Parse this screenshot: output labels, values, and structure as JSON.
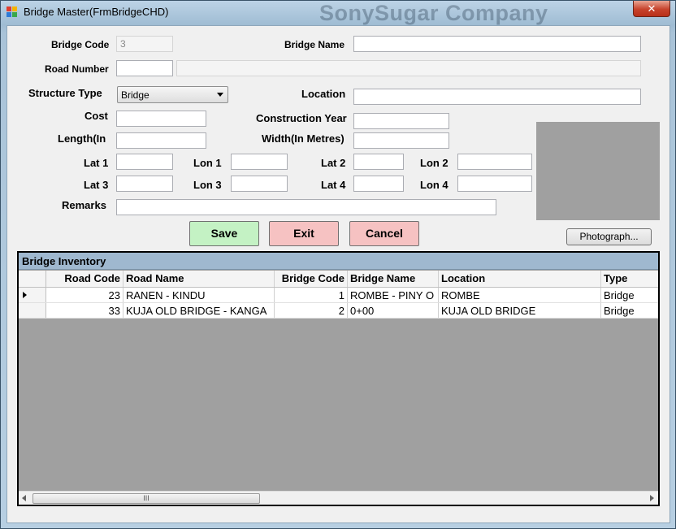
{
  "window": {
    "title": "Bridge Master(FrmBridgeCHD)",
    "watermark": "SonySugar Company",
    "close_glyph": "✕"
  },
  "form": {
    "bridge_code_label": "Bridge Code",
    "bridge_code_value": "3",
    "bridge_name_label": "Bridge Name",
    "bridge_name_value": "",
    "road_number_label": "Road Number",
    "road_number_value": "",
    "road_name_value": "",
    "structure_type_label": "Structure Type",
    "structure_type_value": "Bridge",
    "location_label": "Location",
    "location_value": "",
    "cost_label": "Cost",
    "cost_value": "",
    "construction_year_label": "Construction Year",
    "construction_year_value": "",
    "length_label": "Length(In",
    "length_value": "",
    "width_label": "Width(In Metres)",
    "width_value": "",
    "lat1_label": "Lat 1",
    "lon1_label": "Lon 1",
    "lat2_label": "Lat 2",
    "lon2_label": "Lon 2",
    "lat3_label": "Lat 3",
    "lon3_label": "Lon 3",
    "lat4_label": "Lat 4",
    "lon4_label": "Lon 4",
    "remarks_label": "Remarks",
    "remarks_value": ""
  },
  "buttons": {
    "save": "Save",
    "exit": "Exit",
    "cancel": "Cancel",
    "photograph": "Photograph..."
  },
  "grid": {
    "caption": "Bridge Inventory",
    "columns": [
      "Road Code",
      "Road Name",
      "Bridge Code",
      "Bridge Name",
      "Location",
      "Type"
    ],
    "rows": [
      {
        "road_code": "23",
        "road_name": "RANEN - KINDU",
        "bridge_code": "1",
        "bridge_name": "ROMBE - PINY O",
        "location": "ROMBE",
        "type": "Bridge"
      },
      {
        "road_code": "33",
        "road_name": "KUJA OLD BRIDGE - KANGA",
        "bridge_code": "2",
        "bridge_name": "0+00",
        "location": "KUJA OLD BRIDGE",
        "type": "Bridge"
      }
    ],
    "scroll_thumb_glyph": "III"
  },
  "colors": {
    "save_bg": "#c4f2c4",
    "exit_bg": "#f6c2c2",
    "cancel_bg": "#f6c2c2",
    "grid_caption_bg": "#9fb8cf",
    "photo_placeholder": "#a0a0a0"
  }
}
